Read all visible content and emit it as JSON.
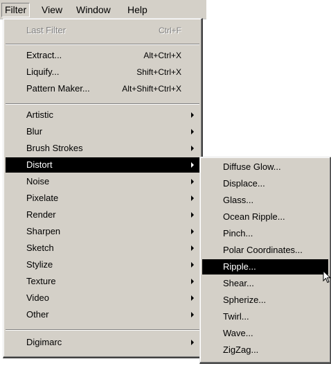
{
  "menubar": {
    "items": [
      {
        "label": "Filter",
        "active": true
      },
      {
        "label": "View",
        "active": false
      },
      {
        "label": "Window",
        "active": false
      },
      {
        "label": "Help",
        "active": false
      }
    ]
  },
  "filter_menu": {
    "last_filter": {
      "label": "Last Filter",
      "shortcut": "Ctrl+F",
      "enabled": false
    },
    "group1": [
      {
        "label": "Extract...",
        "shortcut": "Alt+Ctrl+X"
      },
      {
        "label": "Liquify...",
        "shortcut": "Shift+Ctrl+X"
      },
      {
        "label": "Pattern Maker...",
        "shortcut": "Alt+Shift+Ctrl+X"
      }
    ],
    "categories": [
      "Artistic",
      "Blur",
      "Brush Strokes",
      "Distort",
      "Noise",
      "Pixelate",
      "Render",
      "Sharpen",
      "Sketch",
      "Stylize",
      "Texture",
      "Video",
      "Other"
    ],
    "highlighted_category": "Distort",
    "footer": [
      "Digimarc"
    ]
  },
  "distort_submenu": {
    "items": [
      "Diffuse Glow...",
      "Displace...",
      "Glass...",
      "Ocean Ripple...",
      "Pinch...",
      "Polar Coordinates...",
      "Ripple...",
      "Shear...",
      "Spherize...",
      "Twirl...",
      "Wave...",
      "ZigZag..."
    ],
    "highlighted_item": "Ripple..."
  },
  "colors": {
    "menu_bg": "#d4d0c8",
    "highlight_bg": "#000000",
    "highlight_text": "#ffffff",
    "disabled_text": "#808080"
  }
}
